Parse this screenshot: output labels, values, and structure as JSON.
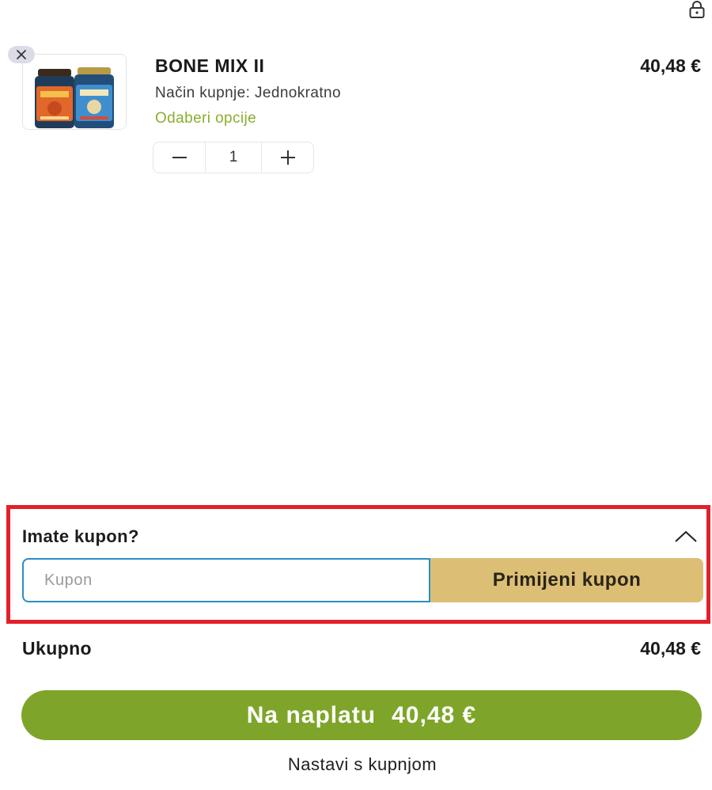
{
  "header": {
    "lock_icon": "lock-icon"
  },
  "cart": {
    "items": [
      {
        "name": "BONE MIX II",
        "price": "40,48 €",
        "purchase_mode": "Način kupnje: Jednokratno",
        "options_link": "Odaberi opcije",
        "quantity": "1",
        "remove_icon": "close-icon",
        "decrease_icon": "minus-icon",
        "increase_icon": "plus-icon"
      }
    ]
  },
  "coupon": {
    "title": "Imate kupon?",
    "input_placeholder": "Kupon",
    "input_value": "",
    "apply_label": "Primijeni kupon",
    "toggle_icon": "chevron-up-icon"
  },
  "summary": {
    "total_label": "Ukupno",
    "total_value": "40,48 €"
  },
  "checkout": {
    "label": "Na naplatu",
    "amount": "40,48 €"
  },
  "continue_label": "Nastavi s kupnjom",
  "colors": {
    "accent_green": "#7ea529",
    "link_green": "#8aae2e",
    "coupon_button": "#dcbf75",
    "input_border": "#2a8ec7",
    "highlight_border": "#e3202a"
  }
}
